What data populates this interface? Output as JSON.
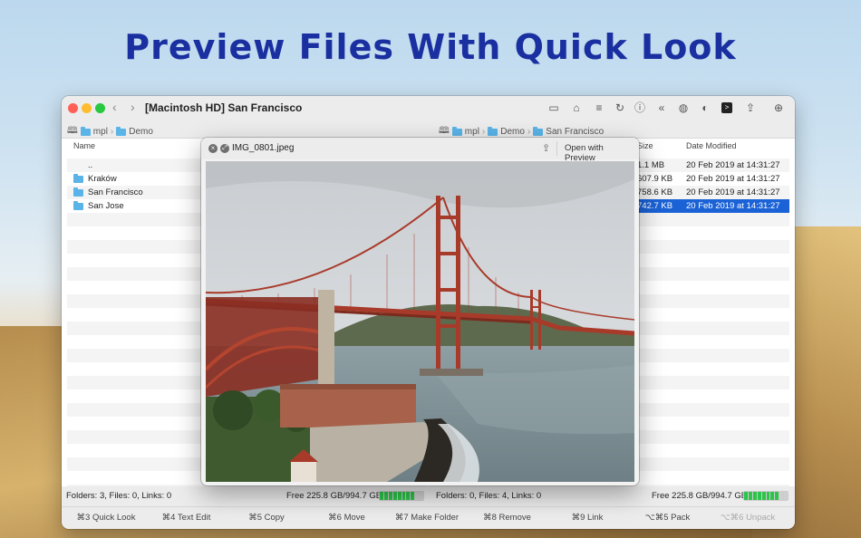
{
  "headline": "Preview Files With Quick Look",
  "window": {
    "title": "[Macintosh HD] San Francisco",
    "toolbar_icons": [
      "display-icon",
      "home-icon",
      "list-icon",
      "refresh-icon",
      "info-icon",
      "rewind-icon",
      "globe-icon",
      "contrast-icon",
      "terminal-icon",
      "share-icon",
      "download-icon"
    ]
  },
  "left_path": [
    "mpl",
    "Demo"
  ],
  "right_path": [
    "mpl",
    "Demo",
    "San Francisco"
  ],
  "left_pane": {
    "col_name": "Name",
    "rows": [
      {
        "name": "..",
        "folder": false
      },
      {
        "name": "Kraków",
        "folder": true
      },
      {
        "name": "San Francisco",
        "folder": true
      },
      {
        "name": "San Jose",
        "folder": true
      }
    ]
  },
  "right_pane": {
    "col_size": "Size",
    "col_date": "Date Modified",
    "rows": [
      {
        "size": "1.1 MB",
        "date": "20 Feb 2019 at 14:31:27",
        "selected": false
      },
      {
        "size": "607.9 KB",
        "date": "20 Feb 2019 at 14:31:27",
        "selected": false
      },
      {
        "size": "758.6 KB",
        "date": "20 Feb 2019 at 14:31:27",
        "selected": false
      },
      {
        "size": "742.7 KB",
        "date": "20 Feb 2019 at 14:31:27",
        "selected": true
      }
    ]
  },
  "status": {
    "left_counts": "Folders: 3, Files: 0, Links: 0",
    "left_free": "Free 225.8 GB/994.7 GB",
    "right_counts": "Folders: 0, Files: 4, Links: 0",
    "right_free": "Free 225.8 GB/994.7 GB",
    "disk_used_fraction": 0.77
  },
  "fkeys": [
    {
      "label": "⌘3 Quick Look",
      "enabled": true
    },
    {
      "label": "⌘4 Text Edit",
      "enabled": true
    },
    {
      "label": "⌘5 Copy",
      "enabled": true
    },
    {
      "label": "⌘6 Move",
      "enabled": true
    },
    {
      "label": "⌘7 Make Folder",
      "enabled": true
    },
    {
      "label": "⌘8 Remove",
      "enabled": true
    },
    {
      "label": "⌘9 Link",
      "enabled": true
    },
    {
      "label": "⌥⌘5 Pack",
      "enabled": true
    },
    {
      "label": "⌥⌘6 Unpack",
      "enabled": false
    }
  ],
  "quicklook": {
    "filename": "IMG_0801.jpeg",
    "open_button": "Open with Preview"
  }
}
